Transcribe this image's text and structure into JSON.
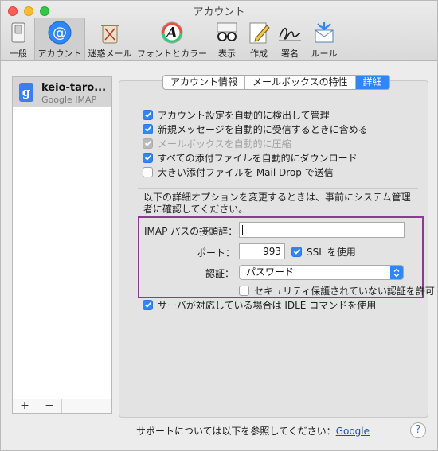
{
  "window": {
    "title": "アカウント"
  },
  "toolbar": {
    "items": [
      {
        "label": "一般",
        "icon": "switch-icon"
      },
      {
        "label": "アカウント",
        "icon": "at-icon"
      },
      {
        "label": "迷惑メール",
        "icon": "trash-icon"
      },
      {
        "label": "フォントとカラー",
        "icon": "font-icon"
      },
      {
        "label": "表示",
        "icon": "glasses-icon"
      },
      {
        "label": "作成",
        "icon": "compose-icon"
      },
      {
        "label": "署名",
        "icon": "signature-icon"
      },
      {
        "label": "ルール",
        "icon": "rules-icon"
      }
    ]
  },
  "sidebar": {
    "account": {
      "name": "keio-taro...",
      "type": "Google IMAP",
      "badge": "g"
    },
    "add_label": "+",
    "remove_label": "−"
  },
  "tabs": [
    {
      "label": "アカウント情報"
    },
    {
      "label": "メールボックスの特性"
    },
    {
      "label": "詳細",
      "active": true
    }
  ],
  "options": [
    {
      "label": "アカウント設定を自動的に検出して管理",
      "checked": true,
      "disabled": false
    },
    {
      "label": "新規メッセージを自動的に受信するときに含める",
      "checked": true,
      "disabled": false
    },
    {
      "label": "メールボックスを自動的に圧縮",
      "checked": true,
      "disabled": true
    },
    {
      "label": "すべての添付ファイルを自動的にダウンロード",
      "checked": true,
      "disabled": false
    },
    {
      "label": "大きい添付ファイルを Mail Drop で送信",
      "checked": false,
      "disabled": false
    }
  ],
  "notice": "以下の詳細オプションを変更するときは、事前にシステム管理者に確認してください。",
  "advanced": {
    "imap_prefix_label": "IMAP パスの接頭辞：",
    "imap_prefix_value": "",
    "port_label": "ポート：",
    "port_value": "993",
    "ssl_label": "SSL を使用",
    "ssl_checked": true,
    "auth_label": "認証：",
    "auth_value": "パスワード",
    "insecure_auth_label": "セキュリティ保護されていない認証を許可",
    "insecure_auth_checked": false
  },
  "idle": {
    "label": "サーバが対応している場合は IDLE コマンドを使用",
    "checked": true
  },
  "footer": {
    "support_text": "サポートについては以下を参照してください：",
    "support_link": "Google",
    "help_label": "?"
  },
  "colors": {
    "accent": "#2f86f5",
    "highlight_border": "#8d3a97"
  }
}
